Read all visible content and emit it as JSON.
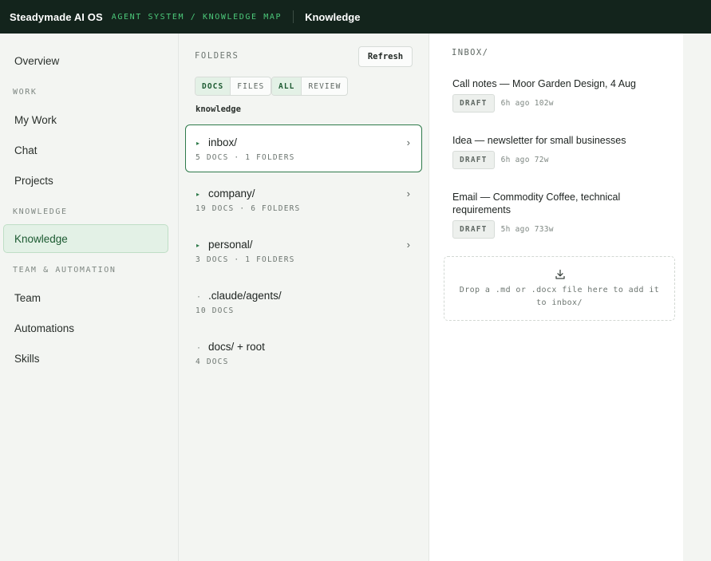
{
  "topbar": {
    "brand": "Steadymade AI OS",
    "breadcrumb": "AGENT SYSTEM / KNOWLEDGE MAP",
    "title": "Knowledge"
  },
  "sidebar": {
    "overview": "Overview",
    "section_work": "WORK",
    "my_work": "My Work",
    "chat": "Chat",
    "projects": "Projects",
    "section_knowledge": "KNOWLEDGE",
    "knowledge": "Knowledge",
    "section_team": "TEAM & AUTOMATION",
    "team": "Team",
    "automations": "Automations",
    "skills": "Skills"
  },
  "folders": {
    "title": "FOLDERS",
    "refresh_label": "Refresh",
    "type_filter": [
      "DOCS",
      "FILES"
    ],
    "status_filter": [
      "ALL",
      "REVIEW"
    ],
    "root": "knowledge",
    "items": [
      {
        "name": "inbox/",
        "meta": "5 DOCS · 1 FOLDERS",
        "marker": "▸",
        "chevron": "›"
      },
      {
        "name": "company/",
        "meta": "19 DOCS · 6 FOLDERS",
        "marker": "▸",
        "chevron": "›"
      },
      {
        "name": "personal/",
        "meta": "3 DOCS · 1 FOLDERS",
        "marker": "▸",
        "chevron": "›"
      },
      {
        "name": ".claude/agents/",
        "meta": "10 DOCS",
        "marker": "·"
      },
      {
        "name": "docs/ + root",
        "meta": "4 DOCS",
        "marker": "·"
      }
    ]
  },
  "docs": {
    "title": "INBOX/",
    "items": [
      {
        "title": "Call notes — Moor Garden Design, 4 Aug",
        "status": "DRAFT",
        "age": "6h ago",
        "words": "102w"
      },
      {
        "title": "Idea — newsletter for small businesses",
        "status": "DRAFT",
        "age": "6h ago",
        "words": "72w"
      },
      {
        "title": "Email — Commodity Coffee, technical requirements",
        "status": "DRAFT",
        "age": "5h ago",
        "words": "733w"
      }
    ],
    "dropzone": {
      "icon": "download-icon",
      "text": "Drop a .md or .docx file here to add it to inbox/"
    }
  },
  "colors": {
    "topbar_bg": "#13241c",
    "accent": "#2e7a4a",
    "breadcrumb": "#4cc97a",
    "active_bg": "#e3f1e6"
  }
}
